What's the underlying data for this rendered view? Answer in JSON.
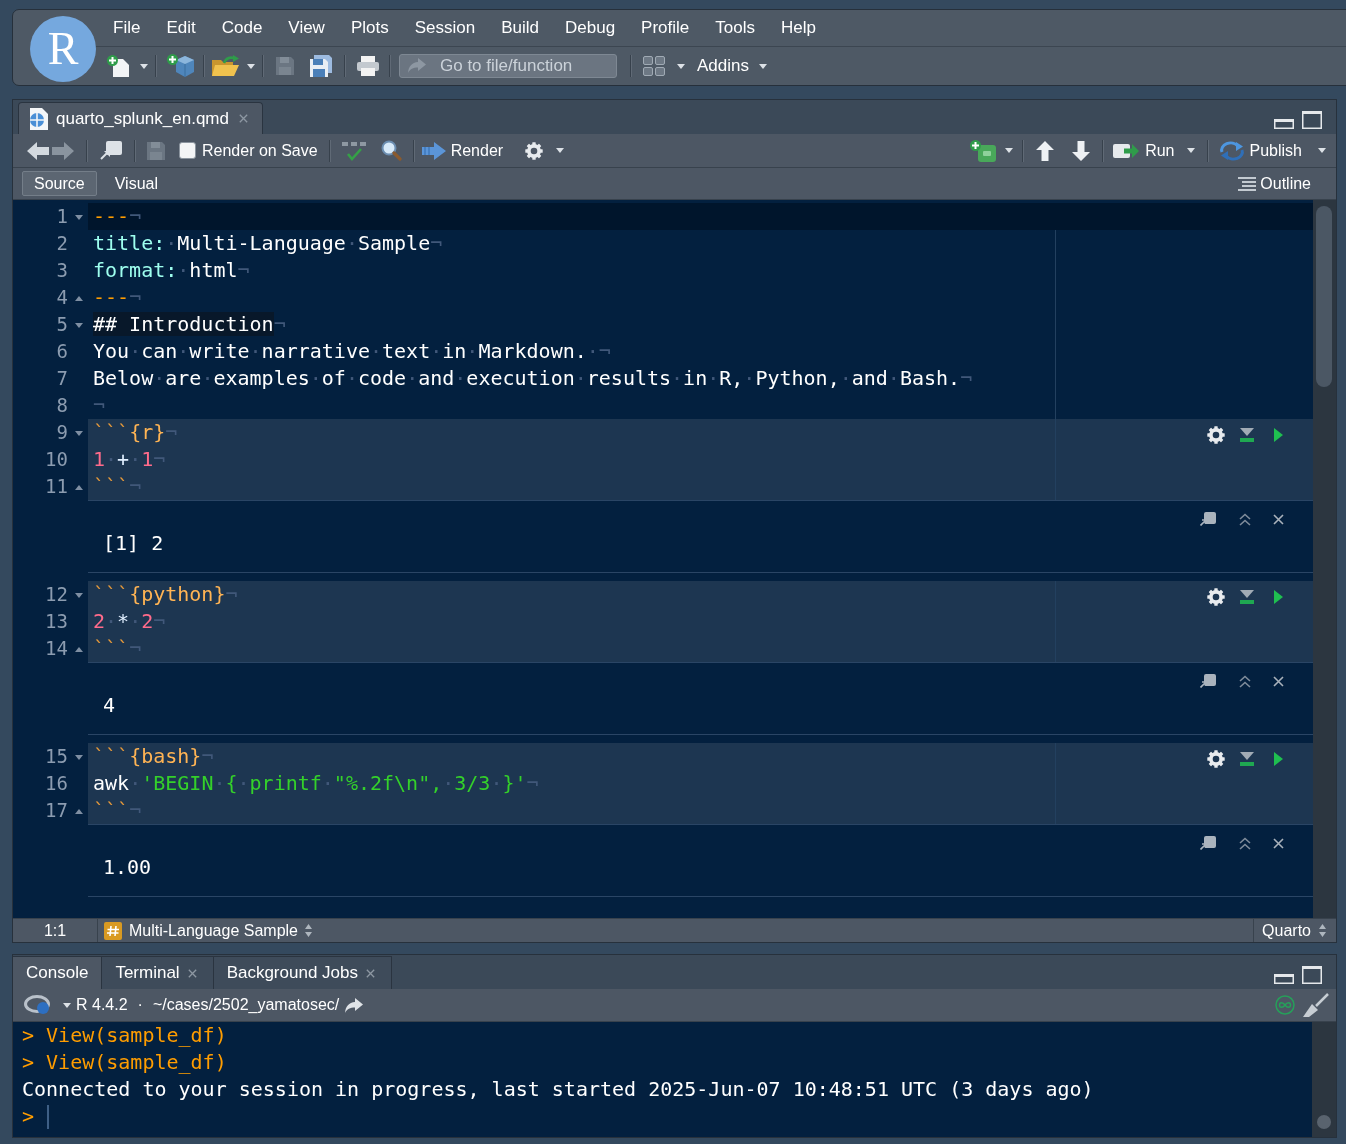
{
  "menu_bar": {
    "logo": "R",
    "items": [
      "File",
      "Edit",
      "Code",
      "View",
      "Plots",
      "Session",
      "Build",
      "Debug",
      "Profile",
      "Tools",
      "Help"
    ]
  },
  "main_toolbar": {
    "goto_field": {
      "placeholder": "Go to file/function"
    },
    "addins": "Addins"
  },
  "editor": {
    "tabs": [
      {
        "label": "quarto_splunk_en.qmd",
        "selected": true,
        "closable": true
      }
    ],
    "toolbar": {
      "render_on_save": {
        "label": "Render on Save",
        "checked": false
      },
      "render": "Render",
      "run": "Run",
      "publish": "Publish"
    },
    "modes": [
      {
        "label": "Source",
        "selected": true
      },
      {
        "label": "Visual",
        "selected": false
      }
    ],
    "outline": "Outline",
    "blocks": [
      {
        "kind": "text",
        "lines": [
          {
            "number": "1",
            "kind": "fold_start",
            "current": true,
            "tokens": [
              {
                "kind": "delim",
                "text": "---"
              },
              {
                "kind": "ws",
                "text": "¬"
              }
            ]
          },
          {
            "number": "2",
            "kind": "line",
            "current": false,
            "tokens": [
              {
                "kind": "key",
                "text": "title:"
              },
              {
                "kind": "ws",
                "text": "·"
              },
              {
                "kind": "plain",
                "text": "Multi-Language"
              },
              {
                "kind": "ws",
                "text": "·"
              },
              {
                "kind": "plain",
                "text": "Sample"
              },
              {
                "kind": "ws",
                "text": "¬"
              }
            ]
          },
          {
            "number": "3",
            "kind": "line",
            "current": false,
            "tokens": [
              {
                "kind": "key",
                "text": "format:"
              },
              {
                "kind": "ws",
                "text": "·"
              },
              {
                "kind": "plain",
                "text": "html"
              },
              {
                "kind": "ws",
                "text": "¬"
              }
            ]
          },
          {
            "number": "4",
            "kind": "fold_end",
            "current": false,
            "tokens": [
              {
                "kind": "delim",
                "text": "---"
              },
              {
                "kind": "ws",
                "text": "¬"
              }
            ]
          },
          {
            "number": "5",
            "kind": "fold_start",
            "current": false,
            "tokens": [
              {
                "kind": "heading",
                "text": "## Introduction"
              },
              {
                "kind": "ws",
                "text": "¬"
              }
            ]
          },
          {
            "number": "6",
            "kind": "line",
            "current": false,
            "tokens": [
              {
                "kind": "plain",
                "text": "You"
              },
              {
                "kind": "ws",
                "text": "·"
              },
              {
                "kind": "plain",
                "text": "can"
              },
              {
                "kind": "ws",
                "text": "·"
              },
              {
                "kind": "plain",
                "text": "write"
              },
              {
                "kind": "ws",
                "text": "·"
              },
              {
                "kind": "plain",
                "text": "narrative"
              },
              {
                "kind": "ws",
                "text": "·"
              },
              {
                "kind": "plain",
                "text": "text"
              },
              {
                "kind": "ws",
                "text": "·"
              },
              {
                "kind": "plain",
                "text": "in"
              },
              {
                "kind": "ws",
                "text": "·"
              },
              {
                "kind": "plain",
                "text": "Markdown."
              },
              {
                "kind": "ws",
                "text": "·¬"
              }
            ]
          },
          {
            "number": "7",
            "kind": "line",
            "current": false,
            "tokens": [
              {
                "kind": "plain",
                "text": "Below"
              },
              {
                "kind": "ws",
                "text": "·"
              },
              {
                "kind": "plain",
                "text": "are"
              },
              {
                "kind": "ws",
                "text": "·"
              },
              {
                "kind": "plain",
                "text": "examples"
              },
              {
                "kind": "ws",
                "text": "·"
              },
              {
                "kind": "plain",
                "text": "of"
              },
              {
                "kind": "ws",
                "text": "·"
              },
              {
                "kind": "plain",
                "text": "code"
              },
              {
                "kind": "ws",
                "text": "·"
              },
              {
                "kind": "plain",
                "text": "and"
              },
              {
                "kind": "ws",
                "text": "·"
              },
              {
                "kind": "plain",
                "text": "execution"
              },
              {
                "kind": "ws",
                "text": "·"
              },
              {
                "kind": "plain",
                "text": "results"
              },
              {
                "kind": "ws",
                "text": "·"
              },
              {
                "kind": "plain",
                "text": "in"
              },
              {
                "kind": "ws",
                "text": "·"
              },
              {
                "kind": "plain",
                "text": "R,"
              },
              {
                "kind": "ws",
                "text": "·"
              },
              {
                "kind": "plain",
                "text": "Python,"
              },
              {
                "kind": "ws",
                "text": "·"
              },
              {
                "kind": "plain",
                "text": "and"
              },
              {
                "kind": "ws",
                "text": "·"
              },
              {
                "kind": "plain",
                "text": "Bash."
              },
              {
                "kind": "ws",
                "text": "¬"
              }
            ]
          },
          {
            "number": "8",
            "kind": "line",
            "current": false,
            "tokens": [
              {
                "kind": "ws",
                "text": "¬"
              }
            ]
          }
        ]
      },
      {
        "kind": "chunk",
        "lines": [
          {
            "number": "9",
            "kind": "fold_start",
            "current": false,
            "tokens": [
              {
                "kind": "fence",
                "text": "```"
              },
              {
                "kind": "lang",
                "text": "{r}"
              },
              {
                "kind": "ws",
                "text": "¬"
              }
            ]
          },
          {
            "number": "10",
            "kind": "line",
            "current": false,
            "tokens": [
              {
                "kind": "num",
                "text": "1"
              },
              {
                "kind": "ws",
                "text": "·"
              },
              {
                "kind": "op",
                "text": "+"
              },
              {
                "kind": "ws",
                "text": "·"
              },
              {
                "kind": "num",
                "text": "1"
              },
              {
                "kind": "ws",
                "text": "¬"
              }
            ]
          },
          {
            "number": "11",
            "kind": "fold_end",
            "current": false,
            "tokens": [
              {
                "kind": "fence",
                "text": "```"
              },
              {
                "kind": "ws",
                "text": "¬"
              }
            ]
          }
        ]
      },
      {
        "kind": "output",
        "text": "[1] 2"
      },
      {
        "kind": "chunk",
        "lines": [
          {
            "number": "12",
            "kind": "fold_start",
            "current": false,
            "tokens": [
              {
                "kind": "fence",
                "text": "```"
              },
              {
                "kind": "lang",
                "text": "{python}"
              },
              {
                "kind": "ws",
                "text": "¬"
              }
            ]
          },
          {
            "number": "13",
            "kind": "line",
            "current": false,
            "tokens": [
              {
                "kind": "num",
                "text": "2"
              },
              {
                "kind": "ws",
                "text": "·"
              },
              {
                "kind": "op",
                "text": "*"
              },
              {
                "kind": "ws",
                "text": "·"
              },
              {
                "kind": "num",
                "text": "2"
              },
              {
                "kind": "ws",
                "text": "¬"
              }
            ]
          },
          {
            "number": "14",
            "kind": "fold_end",
            "current": false,
            "tokens": [
              {
                "kind": "fence",
                "text": "```"
              },
              {
                "kind": "ws",
                "text": "¬"
              }
            ]
          }
        ]
      },
      {
        "kind": "output",
        "text": "4"
      },
      {
        "kind": "chunk",
        "lines": [
          {
            "number": "15",
            "kind": "fold_start",
            "current": false,
            "tokens": [
              {
                "kind": "fence",
                "text": "```"
              },
              {
                "kind": "lang",
                "text": "{bash}"
              },
              {
                "kind": "ws",
                "text": "¬"
              }
            ]
          },
          {
            "number": "16",
            "kind": "line",
            "current": false,
            "tokens": [
              {
                "kind": "plain",
                "text": "awk"
              },
              {
                "kind": "ws",
                "text": "·"
              },
              {
                "kind": "str",
                "text": "'BEGIN"
              },
              {
                "kind": "ws",
                "text": "·"
              },
              {
                "kind": "str",
                "text": "{"
              },
              {
                "kind": "ws",
                "text": "·"
              },
              {
                "kind": "str",
                "text": "printf"
              },
              {
                "kind": "ws",
                "text": "·"
              },
              {
                "kind": "str",
                "text": "\"%.2f\\n\","
              },
              {
                "kind": "ws",
                "text": "·"
              },
              {
                "kind": "str",
                "text": "3/3"
              },
              {
                "kind": "ws",
                "text": "·"
              },
              {
                "kind": "str",
                "text": "}'"
              },
              {
                "kind": "ws",
                "text": "¬"
              }
            ]
          },
          {
            "number": "17",
            "kind": "fold_end",
            "current": false,
            "tokens": [
              {
                "kind": "fence",
                "text": "```"
              },
              {
                "kind": "ws",
                "text": "¬"
              }
            ]
          }
        ]
      },
      {
        "kind": "output",
        "text": "1.00"
      }
    ],
    "status_bar": {
      "position": "1:1",
      "section": "Multi-Language Sample",
      "file_type": "Quarto"
    }
  },
  "console": {
    "tabs": [
      {
        "label": "Console",
        "selected": true,
        "closable": false
      },
      {
        "label": "Terminal",
        "selected": false,
        "closable": true
      },
      {
        "label": "Background Jobs",
        "selected": false,
        "closable": true
      }
    ],
    "version": "R 4.4.2",
    "separator": "·",
    "path": "~/cases/2502_yamatosec/",
    "lines": [
      {
        "kind": "input",
        "text": "> View(sample_df)"
      },
      {
        "kind": "input",
        "text": "> View(sample_df)"
      },
      {
        "kind": "output",
        "text": "Connected to your session in progress, last started 2025-Jun-07 10:48:51 UTC (3 days ago)"
      },
      {
        "kind": "prompt",
        "text": ">"
      }
    ]
  }
}
